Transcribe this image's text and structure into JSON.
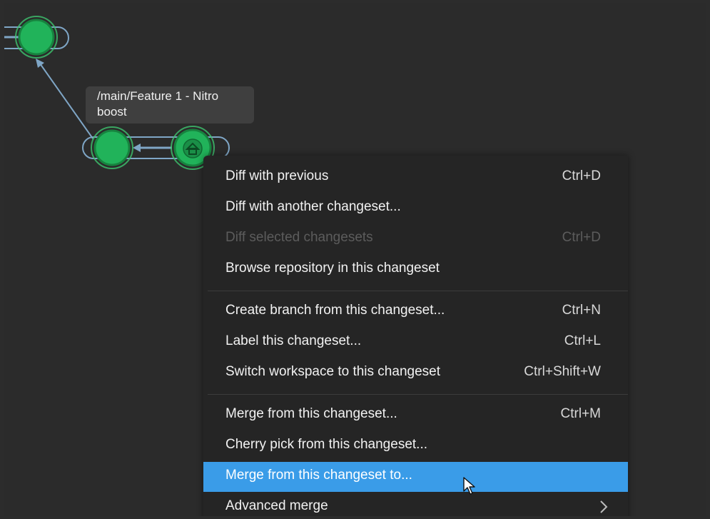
{
  "tooltip": {
    "text": "/main/Feature 1 - Nitro\nboost"
  },
  "graph": {
    "node_color": "#21b35a",
    "ring_color": "#3fc46f",
    "line_color": "#7fa6c6",
    "home_node_icon": "home-icon"
  },
  "context_menu": {
    "highlight_color": "#3a9ce8",
    "items": [
      {
        "label": "Diff with previous",
        "shortcut": "Ctrl+D"
      },
      {
        "label": "Diff with another changeset...",
        "shortcut": ""
      },
      {
        "label": "Diff selected changesets",
        "shortcut": "Ctrl+D",
        "disabled": true
      },
      {
        "label": "Browse repository in this changeset",
        "shortcut": ""
      },
      {
        "label": "Create branch from this changeset...",
        "shortcut": "Ctrl+N"
      },
      {
        "label": "Label this changeset...",
        "shortcut": "Ctrl+L"
      },
      {
        "label": "Switch workspace to this changeset",
        "shortcut": "Ctrl+Shift+W"
      },
      {
        "label": "Merge from this changeset...",
        "shortcut": "Ctrl+M"
      },
      {
        "label": "Cherry pick from this changeset...",
        "shortcut": ""
      },
      {
        "label": "Merge from this changeset to...",
        "shortcut": "",
        "highlighted": true
      },
      {
        "label": "Advanced merge",
        "shortcut": "",
        "submenu_icon": "chevron-right-icon"
      }
    ]
  }
}
